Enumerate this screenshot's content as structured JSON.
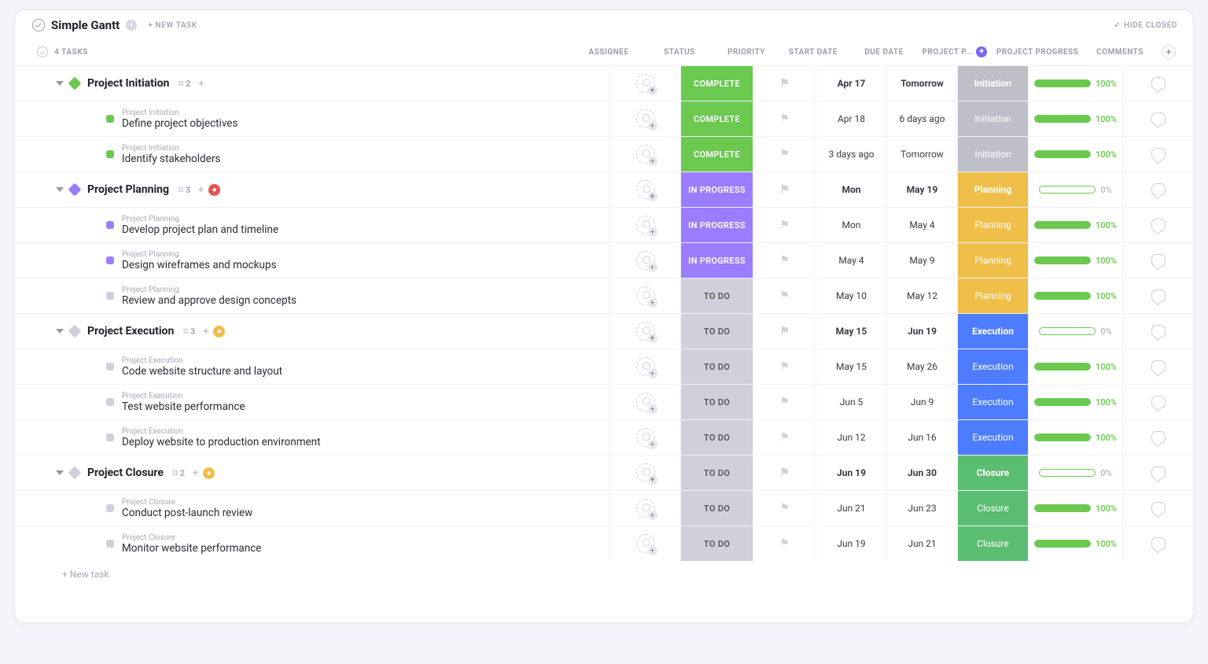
{
  "header": {
    "title": "Simple Gantt",
    "new_task": "+ NEW TASK",
    "hide_closed": "HIDE CLOSED",
    "task_count": "4 TASKS"
  },
  "columns": {
    "assignee": "ASSIGNEE",
    "status": "STATUS",
    "priority": "PRIORITY",
    "start": "START DATE",
    "due": "DUE DATE",
    "phase": "PROJECT P...",
    "progress": "PROJECT PROGRESS",
    "comments": "COMMENTS"
  },
  "status_labels": {
    "complete": "COMPLETE",
    "progress": "IN PROGRESS",
    "todo": "TO DO"
  },
  "phase_labels": {
    "init": "Initiation",
    "plan": "Planning",
    "exec": "Execution",
    "close": "Closure"
  },
  "footer": {
    "new_task": "+ New task"
  },
  "groups": [
    {
      "name": "Project Initiation",
      "color": "green",
      "count": "2",
      "chip": null,
      "status": "complete",
      "phase": "init",
      "start": "Apr 17",
      "due": "Tomorrow",
      "progress": 100,
      "tasks": [
        {
          "crumb": "Project Initiation",
          "name": "Define project objectives",
          "color": "green",
          "status": "complete",
          "phase": "init",
          "start": "Apr 18",
          "due": "6 days ago",
          "progress": 100
        },
        {
          "crumb": "Project Initiation",
          "name": "Identify stakeholders",
          "color": "green",
          "status": "complete",
          "phase": "init",
          "start": "3 days ago",
          "due": "Tomorrow",
          "progress": 100
        }
      ]
    },
    {
      "name": "Project Planning",
      "color": "purple",
      "count": "3",
      "chip": "red",
      "status": "progress",
      "phase": "plan",
      "start": "Mon",
      "due": "May 19",
      "progress": 0,
      "tasks": [
        {
          "crumb": "Project Planning",
          "name": "Develop project plan and timeline",
          "color": "purple",
          "status": "progress",
          "phase": "plan",
          "start": "Mon",
          "due": "May 4",
          "progress": 100
        },
        {
          "crumb": "Project Planning",
          "name": "Design wireframes and mockups",
          "color": "purple",
          "status": "progress",
          "phase": "plan",
          "start": "May 4",
          "due": "May 9",
          "progress": 100
        },
        {
          "crumb": "Project Planning",
          "name": "Review and approve design concepts",
          "color": "grey",
          "status": "todo",
          "phase": "plan",
          "start": "May 10",
          "due": "May 12",
          "progress": 100
        }
      ]
    },
    {
      "name": "Project Execution",
      "color": "grey",
      "count": "3",
      "chip": "yellow",
      "status": "todo",
      "phase": "exec",
      "start": "May 15",
      "due": "Jun 19",
      "progress": 0,
      "tasks": [
        {
          "crumb": "Project Execution",
          "name": "Code website structure and layout",
          "color": "grey",
          "status": "todo",
          "phase": "exec",
          "start": "May 15",
          "due": "May 26",
          "progress": 100
        },
        {
          "crumb": "Project Execution",
          "name": "Test website performance",
          "color": "grey",
          "status": "todo",
          "phase": "exec",
          "start": "Jun 5",
          "due": "Jun 9",
          "progress": 100
        },
        {
          "crumb": "Project Execution",
          "name": "Deploy website to production environment",
          "color": "grey",
          "status": "todo",
          "phase": "exec",
          "start": "Jun 12",
          "due": "Jun 16",
          "progress": 100
        }
      ]
    },
    {
      "name": "Project Closure",
      "color": "grey",
      "count": "2",
      "chip": "yellow",
      "status": "todo",
      "phase": "close",
      "start": "Jun 19",
      "due": "Jun 30",
      "progress": 0,
      "tasks": [
        {
          "crumb": "Project Closure",
          "name": "Conduct post-launch review",
          "color": "grey",
          "status": "todo",
          "phase": "close",
          "start": "Jun 21",
          "due": "Jun 23",
          "progress": 100
        },
        {
          "crumb": "Project Closure",
          "name": "Monitor website performance",
          "color": "grey",
          "status": "todo",
          "phase": "close",
          "start": "Jun 19",
          "due": "Jun 21",
          "progress": 100
        }
      ]
    }
  ]
}
